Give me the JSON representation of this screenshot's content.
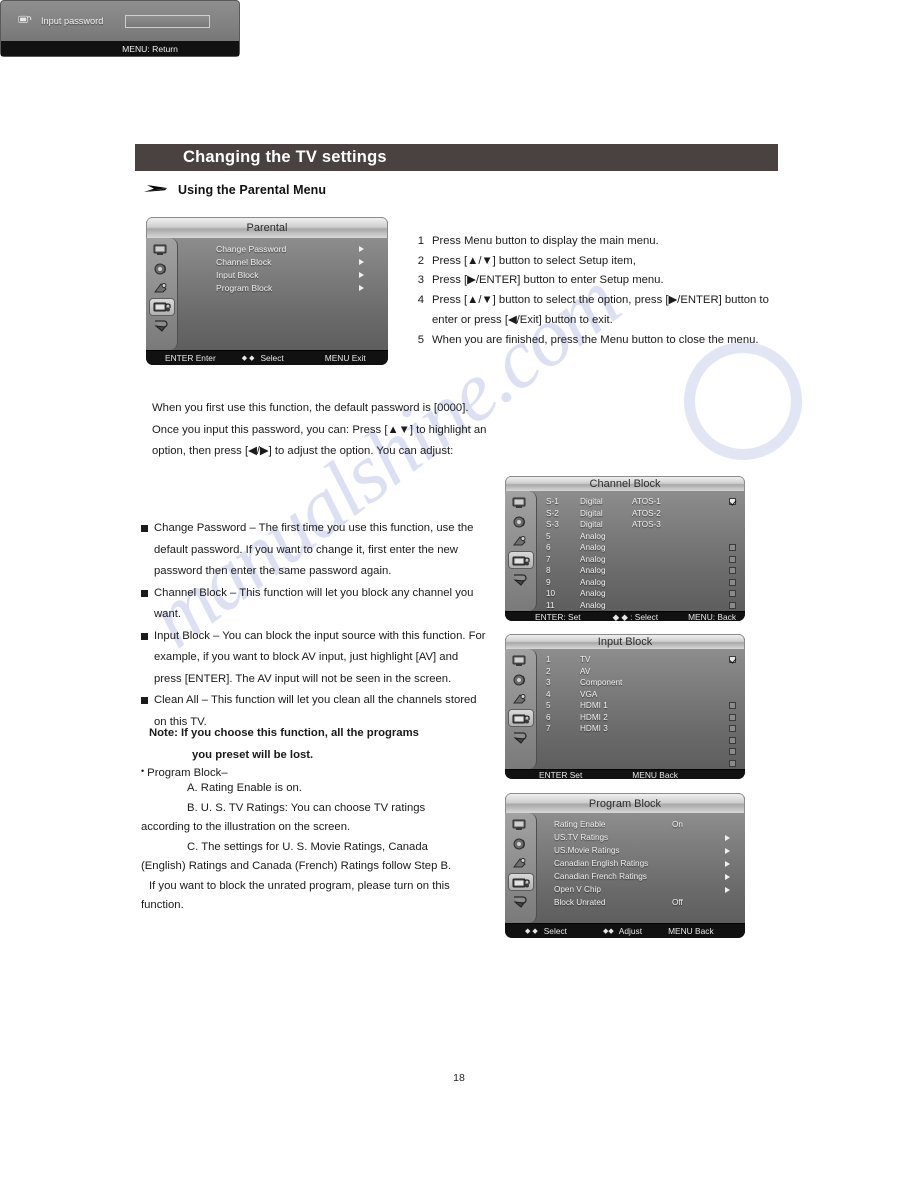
{
  "header": {
    "title": "Changing the TV settings",
    "subsection": "Using the Parental Menu",
    "arrow_icon": "arrow-bullet-icon"
  },
  "page_number": "18",
  "watermark": "manualshine.com",
  "steps": [
    {
      "n": "1",
      "text": "Press Menu button to display the main menu."
    },
    {
      "n": "2",
      "text": "Press [▲/▼] button to select Setup item,"
    },
    {
      "n": "3",
      "text": "Press [▶/ENTER] button to enter Setup menu."
    },
    {
      "n": "4",
      "text": "Press [▲/▼] button to select the option, press [▶/ENTER] button to enter or press [◀/Exit] button to exit."
    },
    {
      "n": "5",
      "text": "When you are finished, press the Menu button to close the menu."
    }
  ],
  "intro_paragraph": "When you first use this function, the default password is [0000]. Once you input this password, you can: Press [▲▼] to highlight an option, then press [◀/▶] to adjust the option. You can adjust:",
  "bullets": [
    "Change Password – The first time you use this function, use the default password. If you want to change it, first enter the new password then enter the same password again.",
    "Channel Block – This function will let you block any channel you want.",
    "Input Block – You can block the input source with this function. For example, if you want to block AV input, just highlight [AV] and press [ENTER]. The AV input will not be seen in the screen.",
    "Clean All – This function will let you clean all the channels stored on this TV."
  ],
  "note": {
    "label": "Note:",
    "line1": "If you choose this function, all the programs",
    "line2": "you preset will be lost."
  },
  "program_block_notes": {
    "heading": "Program Block–",
    "a": "A. Rating Enable is on.",
    "b": "B. U. S. TV Ratings: You can choose TV ratings",
    "b2": "according to the illustration on the screen.",
    "c": "C. The settings for U. S. Movie Ratings, Canada",
    "c2": "(English) Ratings and Canada (French) Ratings follow Step B.",
    "c3": "If you want to block the unrated program, please turn on this",
    "c4": "function."
  },
  "osd": {
    "sidebar_icons": [
      "picture-icon",
      "audio-icon",
      "function-icon",
      "parental-lock-icon",
      "setup-icon"
    ],
    "parental": {
      "title": "Parental",
      "items": [
        {
          "label": "Change Password",
          "arrow": true
        },
        {
          "label": "Channel Block",
          "arrow": true
        },
        {
          "label": "Input Block",
          "arrow": true
        },
        {
          "label": "Program Block",
          "arrow": true
        }
      ],
      "footer": {
        "left": "ENTER Enter",
        "mid_icon": "◆ ◆",
        "mid": "Select",
        "right": "MENU Exit"
      }
    },
    "password": {
      "icon": "lock-icon",
      "label": "Input password",
      "input_value": "",
      "footer": "MENU: Return"
    },
    "channel_block": {
      "title": "Channel Block",
      "columns": [
        "number",
        "type",
        "name",
        "checked"
      ],
      "rows": [
        {
          "number": "S-1",
          "type": "Digital",
          "name": "ATOS-1",
          "checked": true,
          "show_box": true
        },
        {
          "number": "S-2",
          "type": "Digital",
          "name": "ATOS-2",
          "checked": false,
          "show_box": false
        },
        {
          "number": "S-3",
          "type": "Digital",
          "name": "ATOS-3",
          "checked": false,
          "show_box": false
        },
        {
          "number": "5",
          "type": "Analog",
          "name": "",
          "checked": false,
          "show_box": false
        },
        {
          "number": "6",
          "type": "Analog",
          "name": "",
          "checked": false,
          "show_box": true
        },
        {
          "number": "7",
          "type": "Analog",
          "name": "",
          "checked": false,
          "show_box": true
        },
        {
          "number": "8",
          "type": "Analog",
          "name": "",
          "checked": false,
          "show_box": true
        },
        {
          "number": "9",
          "type": "Analog",
          "name": "",
          "checked": false,
          "show_box": true
        },
        {
          "number": "10",
          "type": "Analog",
          "name": "",
          "checked": false,
          "show_box": true
        },
        {
          "number": "11",
          "type": "Analog",
          "name": "",
          "checked": false,
          "show_box": true
        }
      ],
      "footer": {
        "left": "ENTER: Set",
        "mid": "◆ ◆ : Select",
        "right": "MENU: Back"
      }
    },
    "input_block": {
      "title": "Input Block",
      "rows": [
        {
          "number": "1",
          "name": "TV",
          "checked": true,
          "show_box": true
        },
        {
          "number": "2",
          "name": "AV",
          "checked": false,
          "show_box": false
        },
        {
          "number": "3",
          "name": "Component",
          "checked": false,
          "show_box": false
        },
        {
          "number": "4",
          "name": "VGA",
          "checked": false,
          "show_box": false
        },
        {
          "number": "5",
          "name": "HDMI 1",
          "checked": false,
          "show_box": true
        },
        {
          "number": "6",
          "name": "HDMI 2",
          "checked": false,
          "show_box": true
        },
        {
          "number": "7",
          "name": "HDMI 3",
          "checked": false,
          "show_box": true
        },
        {
          "number": "",
          "name": "",
          "checked": false,
          "show_box": true
        },
        {
          "number": "",
          "name": "",
          "checked": false,
          "show_box": true
        },
        {
          "number": "",
          "name": "",
          "checked": false,
          "show_box": true
        }
      ],
      "footer": {
        "left": "ENTER Set",
        "right": "MENU Back"
      }
    },
    "program_block": {
      "title": "Program Block",
      "rows": [
        {
          "label": "Rating Enable",
          "value": "On",
          "arrow": false
        },
        {
          "label": "US.TV Ratings",
          "value": "",
          "arrow": true
        },
        {
          "label": "US.Movie Ratings",
          "value": "",
          "arrow": true
        },
        {
          "label": "Canadian English Ratings",
          "value": "",
          "arrow": true
        },
        {
          "label": "Canadian French Ratings",
          "value": "",
          "arrow": true
        },
        {
          "label": "Open V Chip",
          "value": "",
          "arrow": true
        },
        {
          "label": "Block Unrated",
          "value": "Off",
          "arrow": false
        }
      ],
      "footer": {
        "left_icon": "◆ ◆",
        "left": "Select",
        "mid_icon": "◆◆",
        "mid": "Adjust",
        "right": "MENU Back"
      }
    }
  },
  "colors": {
    "header_bar": "#494241",
    "osd_bottom": "#111111",
    "watermark": "#8e9cd6"
  }
}
